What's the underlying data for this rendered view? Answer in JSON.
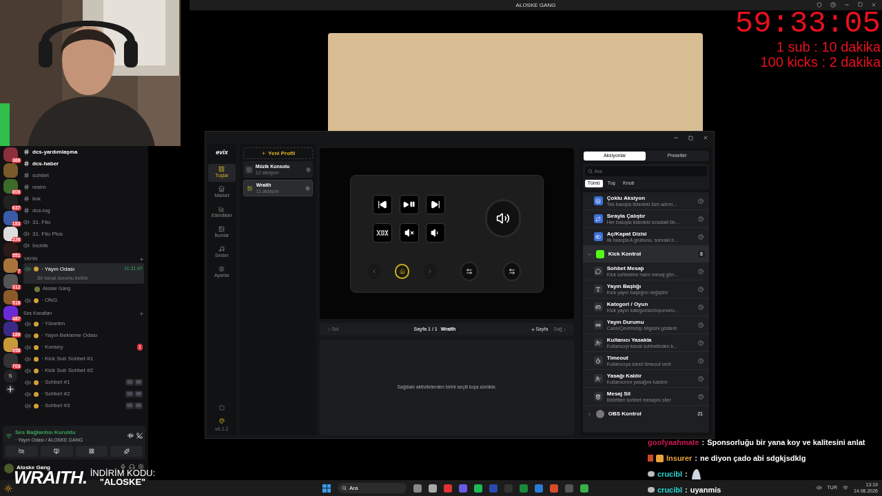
{
  "top_bar": {
    "title": "ALOSKE GANG"
  },
  "timer": {
    "time": "59:33:05",
    "rules": [
      "1 sub : 10 dakika",
      "100 kicks : 2 dakika"
    ]
  },
  "servers": [
    {
      "kind": "guild",
      "badge": "366"
    },
    {
      "kind": "guild"
    },
    {
      "kind": "guild",
      "badge": "808"
    },
    {
      "kind": "guild",
      "badge": "637"
    },
    {
      "kind": "guild",
      "badge": "183"
    },
    {
      "kind": "guild",
      "badge": "226"
    },
    {
      "kind": "guild",
      "badge": "551"
    },
    {
      "kind": "guild",
      "badge": "7"
    },
    {
      "kind": "guild",
      "badge": "312"
    },
    {
      "kind": "guild",
      "badge": "518"
    },
    {
      "kind": "guild",
      "badge": "487"
    },
    {
      "kind": "guild",
      "badge": "189"
    },
    {
      "kind": "guild",
      "badge": "958"
    },
    {
      "kind": "guild",
      "badge": "703"
    }
  ],
  "server_letter": "S",
  "channels": [
    {
      "kind": "text",
      "name": "dcs-yardımlaşma",
      "unread": true
    },
    {
      "kind": "text",
      "name": "dcs-haber",
      "unread": true
    },
    {
      "kind": "text",
      "name": "sohbet",
      "unread": false
    },
    {
      "kind": "text",
      "name": "resim",
      "unread": false
    },
    {
      "kind": "text",
      "name": "link",
      "unread": false
    },
    {
      "kind": "text",
      "name": "dcs-log",
      "unread": false
    },
    {
      "kind": "voice",
      "name": "31. Filo",
      "unread": false
    },
    {
      "kind": "voice",
      "name": "31. Filo Plus",
      "unread": false
    },
    {
      "kind": "voice",
      "name": "İncirlik",
      "unread": false
    }
  ],
  "categories": [
    {
      "name": "YAYIN",
      "channels": [
        {
          "name": "· Yayın Odası",
          "selected": true,
          "time": "11:31:47",
          "status": "Bir kanal durumu belirle",
          "members": [
            "Aloske Gang"
          ]
        },
        {
          "name": "· ONG",
          "selected": false
        }
      ]
    },
    {
      "name": "Ses Kanalları",
      "channels": [
        {
          "name": "· Yönetim",
          "selected": false
        },
        {
          "name": "· Yayın Bekleme Odası",
          "selected": false
        },
        {
          "name": "· Konsey",
          "selected": false,
          "mention": "1"
        },
        {
          "name": "· Kick Sub Sohbet #1",
          "selected": false
        },
        {
          "name": "· Kick Sub Sohbet #2",
          "selected": false
        },
        {
          "name": "· Sohbet #1",
          "selected": false,
          "counts": [
            "00",
            "99"
          ]
        },
        {
          "name": "· Sohbet #2",
          "selected": false,
          "counts": [
            "00",
            "99"
          ]
        },
        {
          "name": "· Sohbet #3",
          "selected": false,
          "counts": [
            "00",
            "99"
          ]
        }
      ]
    }
  ],
  "voice_panel": {
    "title": "Ses Bağlantısı Kuruldu",
    "subtitle": "· Yayın Odası / ALOSKE GANG"
  },
  "user": {
    "name": "Aloske Gang"
  },
  "promo": {
    "brand": "WRAITH.",
    "label": "İNDİRİM KODU:",
    "code": "\"ALOSKE\""
  },
  "app": {
    "logo": "evix",
    "nav": [
      {
        "label": "Tuşlar",
        "selected": true
      },
      {
        "label": "Market",
        "selected": false
      },
      {
        "label": "Etkinlikler",
        "selected": false
      },
      {
        "label": "İkonlar",
        "selected": false
      },
      {
        "label": "Sesler",
        "selected": false
      },
      {
        "label": "Ayarlar",
        "selected": false
      }
    ],
    "version": "v0.1.2",
    "new_profile": "Yeni Profil",
    "profiles": [
      {
        "name": "Müzik Konsolu",
        "count": "12 aksiyon",
        "selected": false
      },
      {
        "name": "Wraith",
        "count": "11 aksiyon",
        "selected": true
      }
    ],
    "pager": {
      "prev": "Sol",
      "page": "Sayfa 1 / 1",
      "profile": "Wraith",
      "add": "Sayfa",
      "next": "Sağ"
    },
    "drop_hint": "Sağdaki aktivitelerden birini seçili tuşa sürükle.",
    "tabs": [
      {
        "label": "Aksiyonlar",
        "selected": true
      },
      {
        "label": "Presetler",
        "selected": false
      }
    ],
    "search": {
      "placeholder": "Ara"
    },
    "filters": [
      {
        "label": "Tümü",
        "selected": true
      },
      {
        "label": "Tuş",
        "selected": false
      },
      {
        "label": "Knob",
        "selected": false
      }
    ],
    "actions": [
      {
        "kind": "item",
        "title": "Çoklu Aksiyon",
        "desc": "Tek basışta listedeki tüm adımı..."
      },
      {
        "kind": "item",
        "title": "Sırayla Çalıştır",
        "desc": "Her basışta listedeki sıradaki bir..."
      },
      {
        "kind": "item",
        "title": "Aç/Kapat Dizisi",
        "desc": "İlk basışta A grubunu, sonraki b..."
      },
      {
        "kind": "group",
        "title": "Kick Kontrol",
        "count": "8",
        "expanded": true,
        "children": [
          {
            "title": "Sohbet Mesajı",
            "desc": "Kick sohbetine hazır mesaj gön..."
          },
          {
            "title": "Yayın Başlığı",
            "desc": "Kick yayın başlığını değiştirir"
          },
          {
            "title": "Kategori / Oyun",
            "desc": "Kick yayın kategorisini/oyununu..."
          },
          {
            "title": "Yayın Durumu",
            "desc": "Canlı/Çevrimdışı bilgisini gösterir"
          },
          {
            "title": "Kullanıcı Yasakla",
            "desc": "Kullanıcıyı kanal sohbetinden k..."
          },
          {
            "title": "Timeout",
            "desc": "Kullanıcıya süreli timeout verir"
          },
          {
            "title": "Yasağı Kaldır",
            "desc": "Kullanıcının yasağını kaldırır"
          },
          {
            "title": "Mesaj Sil",
            "desc": "Belirtilen sohbet mesajını siler"
          }
        ]
      },
      {
        "kind": "group",
        "title": "OBS Kontrol",
        "count": "21",
        "expanded": false
      }
    ]
  },
  "chat": [
    {
      "user": "goofyaahmate",
      "sep": ":",
      "color": "#c8174f",
      "text": "Sponsorluğu bir yana koy ve kalitesini anlat",
      "badges": false,
      "emote": false
    },
    {
      "user": "Insurer",
      "sep": ":",
      "color": "#e8a33a",
      "text": "ne diyon çado abi sdgkjsdklg",
      "badges": true,
      "emote": false
    },
    {
      "user": "crucibl",
      "sep": ":",
      "color": "#2ad4d4",
      "badges": false,
      "emote": true
    },
    {
      "user": "crucibl",
      "sep": ":",
      "color": "#2ad4d4",
      "text": "uyanmis",
      "badges": false,
      "emote": false
    }
  ],
  "taskbar": {
    "search": "Ara",
    "lang": "TUR",
    "time": "13:19",
    "date": "14.08.2026"
  }
}
